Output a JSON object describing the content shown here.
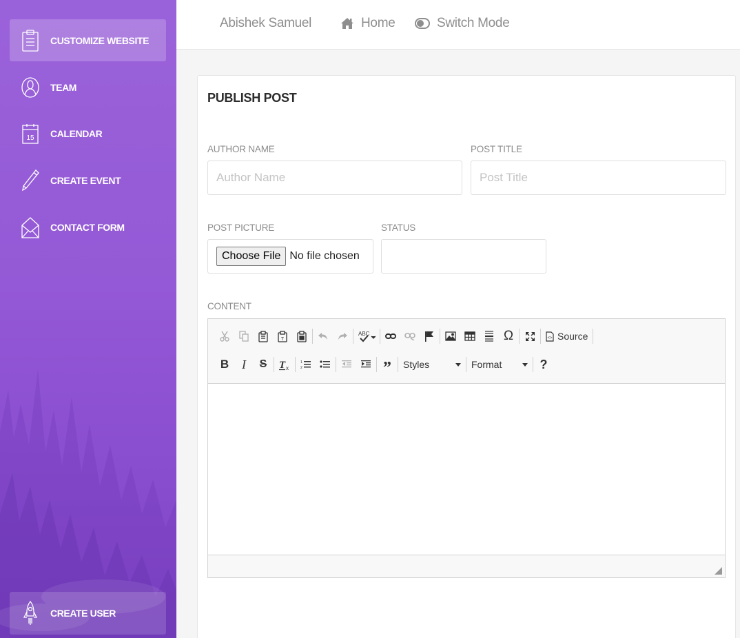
{
  "sidebar": {
    "items": [
      {
        "label": "CUSTOMIZE WEBSITE",
        "icon": "clipboard-icon",
        "active": true
      },
      {
        "label": "TEAM",
        "icon": "user-icon"
      },
      {
        "label": "CALENDAR",
        "icon": "calendar-icon",
        "icon_text": "15"
      },
      {
        "label": "CREATE EVENT",
        "icon": "pencil-icon"
      },
      {
        "label": "CONTACT FORM",
        "icon": "envelope-icon"
      }
    ],
    "footer_item": {
      "label": "CREATE USER",
      "icon": "rocket-icon"
    },
    "gradient_colors": [
      "#9a62da",
      "#7e43c6"
    ]
  },
  "topbar": {
    "user_name": "Abishek Samuel",
    "home_label": "Home",
    "switch_mode_label": "Switch Mode"
  },
  "form": {
    "title": "PUBLISH POST",
    "author_name": {
      "label": "AUTHOR NAME",
      "placeholder": "Author Name",
      "value": ""
    },
    "post_title": {
      "label": "POST TITLE",
      "placeholder": "Post Title",
      "value": ""
    },
    "post_picture": {
      "label": "POST PICTURE",
      "button_label": "Choose File",
      "status_text": "No file chosen"
    },
    "status": {
      "label": "STATUS",
      "value": ""
    },
    "content": {
      "label": "CONTENT",
      "toolbar": {
        "source_label": "Source",
        "styles_label": "Styles",
        "format_label": "Format",
        "help_label": "?"
      },
      "value": ""
    }
  }
}
